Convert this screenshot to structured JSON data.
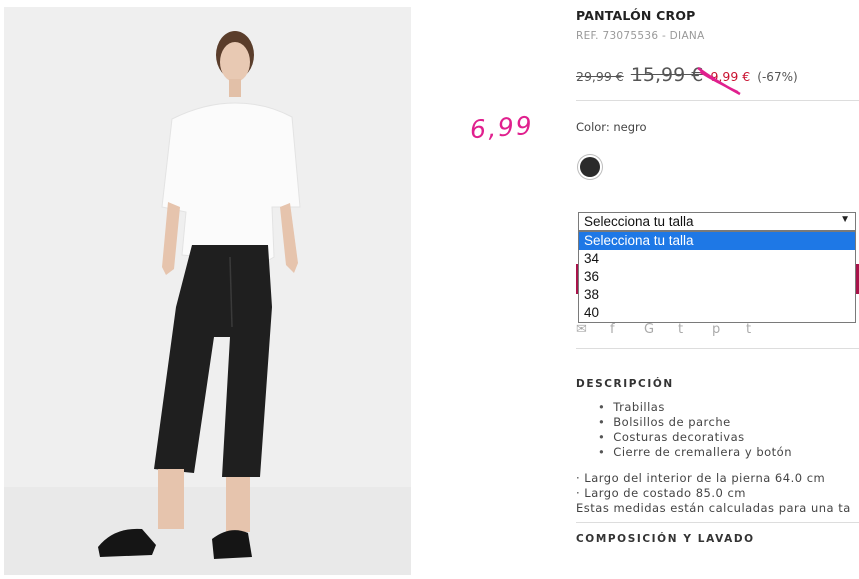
{
  "product": {
    "title": "PANTALÓN CROP",
    "ref": "REF. 73075536 - DIANA",
    "price_original": "29,99 €",
    "price_previous": "15,99 €",
    "price_sale": "9,99 €",
    "discount": "(-67%)",
    "handwritten_price": "6,99",
    "color_label": "Color: negro",
    "swatch_color": "#2b2b2b"
  },
  "size_select": {
    "selected": "Selecciona tu talla",
    "options": [
      "Selecciona tu talla",
      "34",
      "36",
      "38",
      "40"
    ]
  },
  "share_icons": [
    "mail-icon",
    "facebook-icon",
    "google-plus-icon",
    "twitter-icon",
    "pinterest-icon",
    "tumblr-icon"
  ],
  "description": {
    "heading": "DESCRIPCIÓN",
    "bullets": [
      "Trabillas",
      "Bolsillos de parche",
      "Costuras decorativas",
      "Cierre de cremallera y botón"
    ],
    "measures": [
      "· Largo del interior de la pierna 64.0 cm",
      "· Largo de costado 85.0 cm",
      "Estas medidas están calculadas para una ta"
    ]
  },
  "composition": {
    "heading": "COMPOSICIÓN Y LAVADO"
  },
  "colors": {
    "sale": "#c8102e",
    "annotation": "#e0208e",
    "button": "#a8134a",
    "select_highlight": "#1e78e6"
  }
}
